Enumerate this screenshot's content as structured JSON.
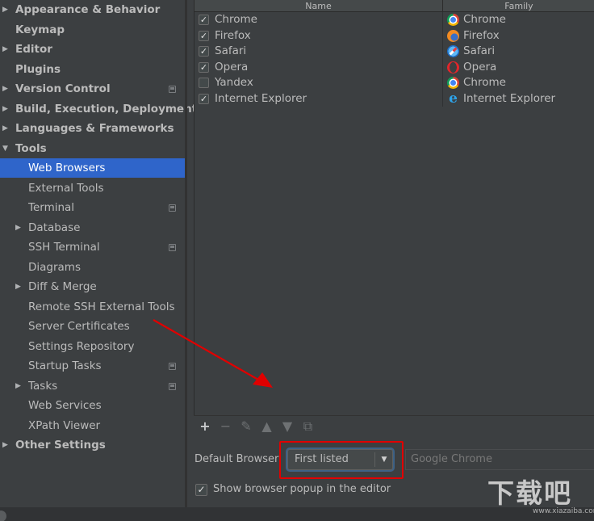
{
  "sidebar": {
    "items": [
      {
        "label": "Appearance & Behavior",
        "arrow": "▶",
        "bold": true
      },
      {
        "label": "Keymap",
        "bold": true
      },
      {
        "label": "Editor",
        "arrow": "▶",
        "bold": true
      },
      {
        "label": "Plugins",
        "bold": true
      },
      {
        "label": "Version Control",
        "arrow": "▶",
        "bold": true,
        "project_icon": true
      },
      {
        "label": "Build, Execution, Deployment",
        "arrow": "▶",
        "bold": true
      },
      {
        "label": "Languages & Frameworks",
        "arrow": "▶",
        "bold": true
      },
      {
        "label": "Tools",
        "arrow": "▼",
        "bold": true
      },
      {
        "label": "Web Browsers",
        "child": true,
        "selected": true
      },
      {
        "label": "External Tools",
        "child": true
      },
      {
        "label": "Terminal",
        "child": true,
        "project_icon": true
      },
      {
        "label": "Database",
        "child": true,
        "arrow": "▶"
      },
      {
        "label": "SSH Terminal",
        "child": true,
        "project_icon": true
      },
      {
        "label": "Diagrams",
        "child": true
      },
      {
        "label": "Diff & Merge",
        "child": true,
        "arrow": "▶"
      },
      {
        "label": "Remote SSH External Tools",
        "child": true
      },
      {
        "label": "Server Certificates",
        "child": true
      },
      {
        "label": "Settings Repository",
        "child": true
      },
      {
        "label": "Startup Tasks",
        "child": true,
        "project_icon": true
      },
      {
        "label": "Tasks",
        "child": true,
        "arrow": "▶",
        "project_icon": true
      },
      {
        "label": "Web Services",
        "child": true
      },
      {
        "label": "XPath Viewer",
        "child": true
      },
      {
        "label": "Other Settings",
        "arrow": "▶",
        "bold": true
      }
    ]
  },
  "browsers_table": {
    "headers": {
      "name": "Name",
      "family": "Family"
    },
    "rows": [
      {
        "checked": true,
        "name": "Chrome",
        "family": "Chrome",
        "icon": "chrome-icon"
      },
      {
        "checked": true,
        "name": "Firefox",
        "family": "Firefox",
        "icon": "firefox-icon"
      },
      {
        "checked": true,
        "name": "Safari",
        "family": "Safari",
        "icon": "safari-icon"
      },
      {
        "checked": true,
        "name": "Opera",
        "family": "Opera",
        "icon": "opera-icon"
      },
      {
        "checked": false,
        "name": "Yandex",
        "family": "Chrome",
        "icon": "chrome-icon"
      },
      {
        "checked": true,
        "name": "Internet Explorer",
        "family": "Internet Explorer",
        "icon": "ie-icon"
      }
    ],
    "toolbar": [
      {
        "name": "add",
        "glyph": "+",
        "enabled": true
      },
      {
        "name": "remove",
        "glyph": "−",
        "enabled": false
      },
      {
        "name": "edit",
        "glyph": "✎",
        "enabled": false
      },
      {
        "name": "move-up",
        "glyph": "▲",
        "enabled": false
      },
      {
        "name": "move-down",
        "glyph": "▼",
        "enabled": false
      },
      {
        "name": "copy",
        "glyph": "⧉",
        "enabled": false
      }
    ]
  },
  "default_browser": {
    "label": "Default Browser:",
    "selected": "First listed",
    "path_text": "Google Chrome"
  },
  "popup_option": {
    "checked": true,
    "label": "Show browser popup in the editor"
  },
  "watermark": {
    "text": "下载吧",
    "url": "www.xiazaiba.com"
  },
  "colors": {
    "selection": "#2f65ca",
    "annotation": "#e00000",
    "background": "#3c3f41"
  },
  "checkbox_glyph": "✓"
}
